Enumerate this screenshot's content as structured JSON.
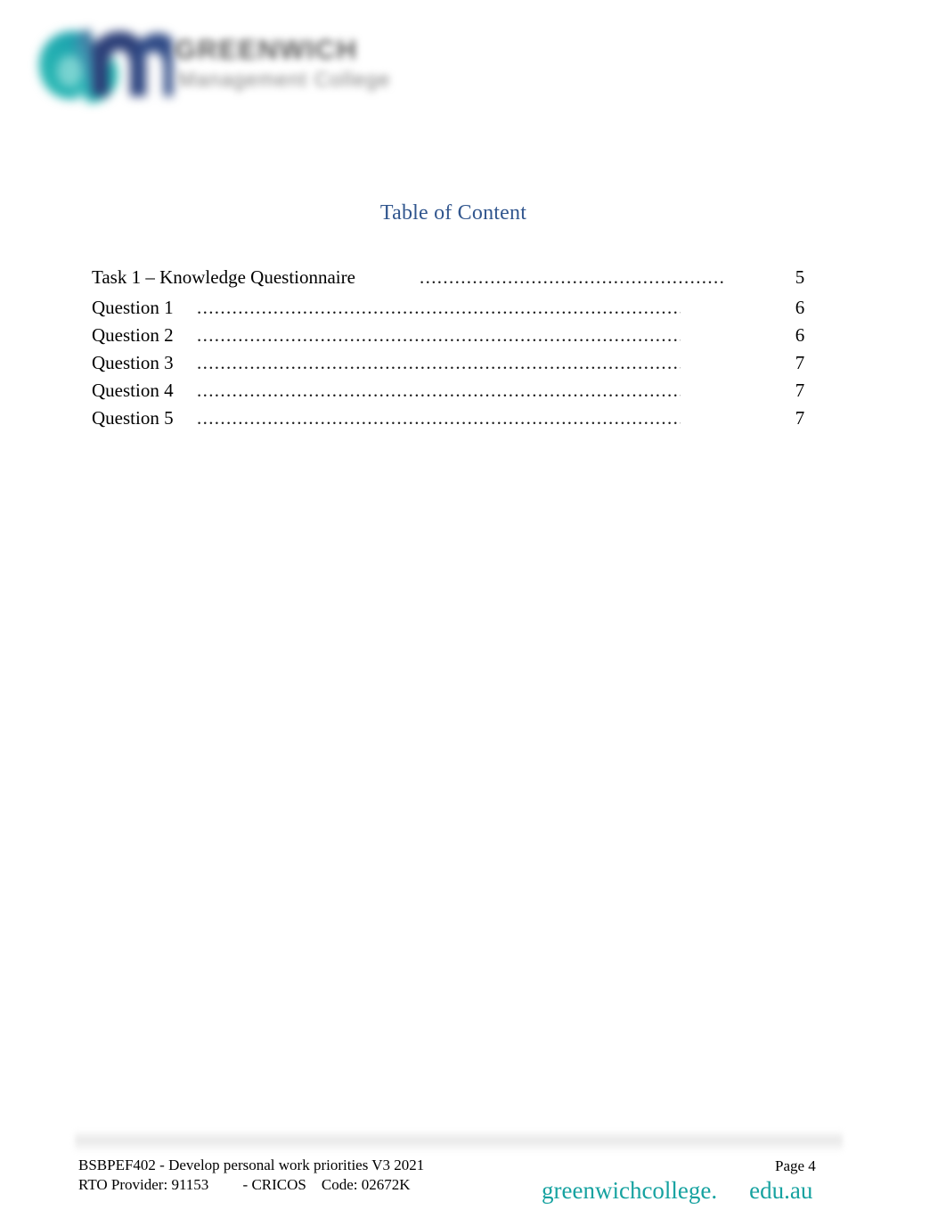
{
  "document": {
    "title": "Table of Content",
    "title_color": "#31568e"
  },
  "logo": {
    "mark_name": "gm-monogram",
    "mark_colors": [
      "#19b3ac",
      "#2f9fb5",
      "#2c3f78"
    ],
    "wordmark_line1": "GREENWICH",
    "wordmark_line2": "Management College"
  },
  "toc": {
    "entries": [
      {
        "label": "Task 1 – Knowledge Questionnaire",
        "dots": "...................................................................",
        "page": "5",
        "level": "lead"
      },
      {
        "label": "Question 1",
        "dots": "...................................................................................................",
        "page": "6",
        "level": "sub"
      },
      {
        "label": "Question 2",
        "dots": "...................................................................................................",
        "page": "6",
        "level": "sub"
      },
      {
        "label": "Question 3",
        "dots": "...................................................................................................",
        "page": "7",
        "level": "sub"
      },
      {
        "label": "Question 4",
        "dots": "...................................................................................................",
        "page": "7",
        "level": "sub"
      },
      {
        "label": "Question 5",
        "dots": "...................................................................................................",
        "page": "7",
        "level": "sub"
      }
    ]
  },
  "footer": {
    "unit_line": "BSBPEF402 - Develop personal work priorities V3 2021",
    "rto_line": "RTO Provider: 91153         - CRICOS    Code: 02672K",
    "page_label": "Page 4",
    "brand_name": "greenwichcollege.",
    "brand_tld": "edu.au",
    "brand_color": "#16a2a0"
  }
}
